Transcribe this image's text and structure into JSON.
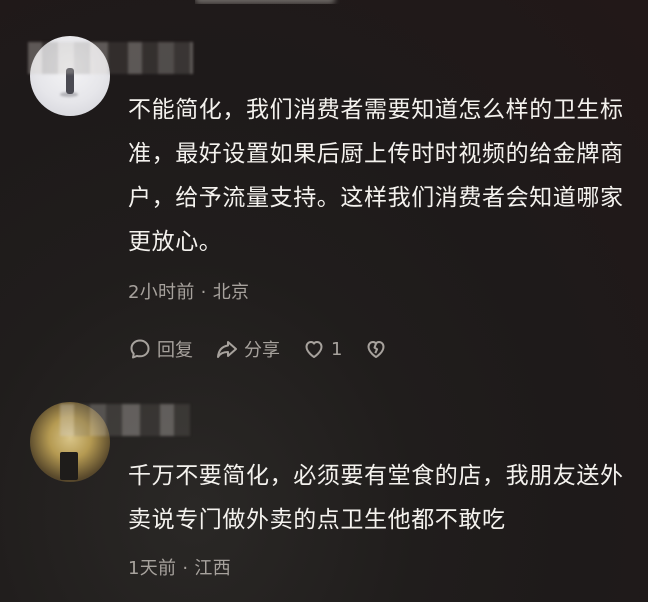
{
  "comments": [
    {
      "text": "不能简化，我们消费者需要知道怎么样的卫生标准，最好设置如果后厨上传时时视频的给金牌商户，给予流量支持。这样我们消费者会知道哪家更放心。",
      "time": "2小时前",
      "location": "北京",
      "reply_label": "回复",
      "share_label": "分享",
      "like_count": "1"
    },
    {
      "text": "千万不要简化，必须要有堂食的店，我朋友送外卖说专门做外卖的点卫生他都不敢吃",
      "time": "1天前",
      "location": "江西"
    }
  ],
  "separator": "·",
  "icons": {
    "reply": "speech-bubble-icon",
    "share": "share-arrow-icon",
    "like": "heart-icon",
    "dislike": "broken-heart-icon"
  },
  "colors": {
    "text": "#f4f2ee",
    "meta": "#a7a29d",
    "background": "#201d1c"
  }
}
